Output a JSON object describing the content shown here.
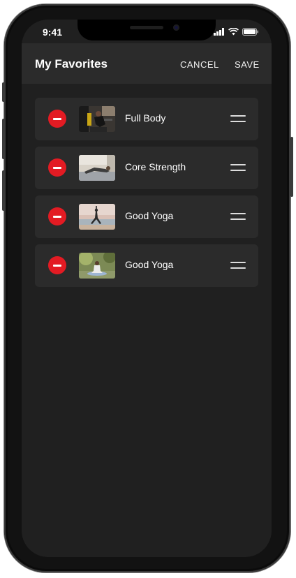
{
  "status_bar": {
    "time": "9:41"
  },
  "header": {
    "title": "My Favorites",
    "cancel_label": "CANCEL",
    "save_label": "SAVE"
  },
  "favorites": [
    {
      "label": "Full Body",
      "thumbnail": "gym-workout-photo"
    },
    {
      "label": "Core Strength",
      "thumbnail": "floor-plank-photo"
    },
    {
      "label": "Good Yoga",
      "thumbnail": "beach-yoga-photo"
    },
    {
      "label": "Good Yoga",
      "thumbnail": "outdoor-yoga-photo"
    }
  ],
  "colors": {
    "accent_red": "#e31b23",
    "background": "#202020",
    "card": "#2b2b2b"
  }
}
